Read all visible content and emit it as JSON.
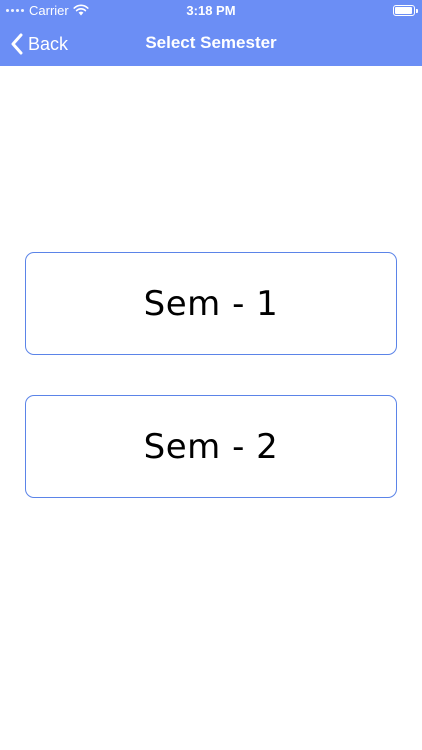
{
  "status_bar": {
    "carrier": "Carrier",
    "time": "3:18 PM",
    "icons": [
      "signal-dots-icon",
      "wifi-icon",
      "battery-icon"
    ]
  },
  "nav_bar": {
    "back_label": "Back",
    "back_icon": "chevron-left-icon",
    "title": "Select Semester",
    "background_color": "#6b8ef5"
  },
  "semesters": [
    {
      "label": "Sem - 1"
    },
    {
      "label": "Sem - 2"
    }
  ],
  "colors": {
    "accent": "#6b8ef5",
    "card_border": "#5b84e8",
    "background": "#ffffff"
  }
}
